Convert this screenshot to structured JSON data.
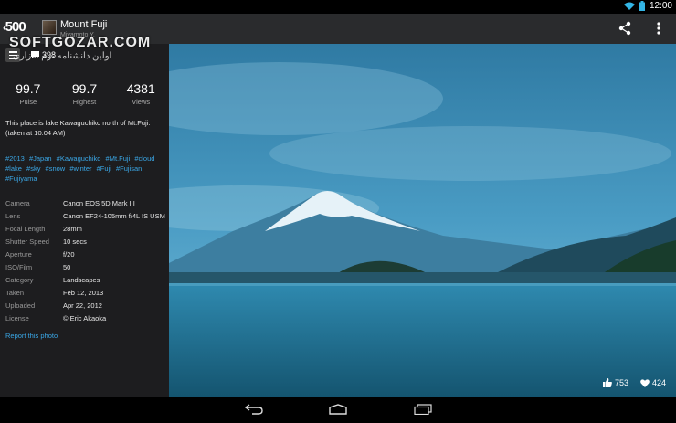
{
  "status": {
    "time": "12:00"
  },
  "app": {
    "logo": "500"
  },
  "header": {
    "title": "Mount Fuji",
    "author": "Miyamoto Y."
  },
  "watermark": {
    "text": "SOFTGOZAR.COM",
    "sub": "اولین دانشنامه نرم افزاری"
  },
  "panel": {
    "comments_count": "398",
    "stats": [
      {
        "value": "99.7",
        "label": "Pulse"
      },
      {
        "value": "99.7",
        "label": "Highest"
      },
      {
        "value": "4381",
        "label": "Views"
      }
    ],
    "description": "This place is lake Kawaguchiko north of Mt.Fuji. (taken at 10:04 AM)",
    "tags": [
      "#2013",
      "#Japan",
      "#Kawaguchiko",
      "#Mt.Fuji",
      "#cloud",
      "#lake",
      "#sky",
      "#snow",
      "#winter",
      "#Fuji",
      "#Fujisan",
      "#Fujiyama"
    ],
    "exif": [
      {
        "key": "Camera",
        "value": "Canon EOS 5D Mark III"
      },
      {
        "key": "Lens",
        "value": "Canon EF24-105mm f/4L IS USM"
      },
      {
        "key": "Focal Length",
        "value": "28mm"
      },
      {
        "key": "Shutter Speed",
        "value": "10 secs"
      },
      {
        "key": "Aperture",
        "value": "f/20"
      },
      {
        "key": "ISO/Film",
        "value": "50"
      },
      {
        "key": "Category",
        "value": "Landscapes"
      },
      {
        "key": "Taken",
        "value": "Feb 12, 2013"
      },
      {
        "key": "Uploaded",
        "value": "Apr 22, 2012"
      },
      {
        "key": "License",
        "value": "© Eric Akaoka"
      }
    ],
    "report_label": "Report this photo"
  },
  "photo": {
    "likes": "753",
    "favorites": "424"
  },
  "icons": {
    "back": "back-arrow-icon",
    "share": "share-icon",
    "menu": "overflow-menu-icon",
    "comment": "comment-bubble-icon",
    "like": "thumbs-up-icon",
    "favorite": "heart-icon"
  },
  "colors": {
    "panel_bg": "#1d1d1f",
    "actionbar_bg": "#2a2b2d",
    "link": "#3aa7e6",
    "sky": "#3f8fb6"
  }
}
